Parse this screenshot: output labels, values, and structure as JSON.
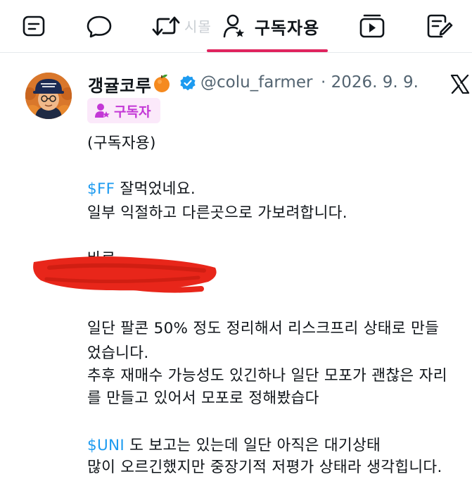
{
  "tabs": {
    "ghost_label": "시몰",
    "active_label": "구독자용"
  },
  "post": {
    "author_name": "갱귤코루",
    "handle": "@colu_farmer",
    "date": "· 2026. 9. 9.",
    "badge_label": "구독자",
    "lines": {
      "l1": "(구독자용)",
      "l2_tag": "$FF",
      "l2_rest": " 잘먹었네요.",
      "l3": "일부 익절하고 다른곳으로 가보려합니다.",
      "l4": "바로",
      "l5": "일단 팔콘 50% 정도 정리해서 리스크프리 상태로 만들",
      "l6": "었습니다.",
      "l7": "추후 재매수 가능성도 있긴하나 일단 모포가 괜찮은 자리",
      "l8": "를 만들고 있어서 모포로 정해봤습다",
      "l9_tag": "$UNI",
      "l9_rest": " 도 보고는 있는데 일단 아직은 대기상태",
      "l10": "많이 오르긴했지만 중장기적 저평가 상태라 생각힙니다."
    }
  },
  "colors": {
    "accent": "#e0245e",
    "link": "#1d9bf0",
    "badge_bg": "#fbe9fa",
    "badge_text": "#c338d6",
    "redaction": "#e8261a"
  },
  "icons": [
    "list-icon",
    "chat-bubble-icon",
    "repost-icon",
    "subscriber-icon",
    "video-icon",
    "edit-note-icon",
    "tangerine-emoji",
    "verified-badge-icon",
    "x-logo-icon"
  ]
}
